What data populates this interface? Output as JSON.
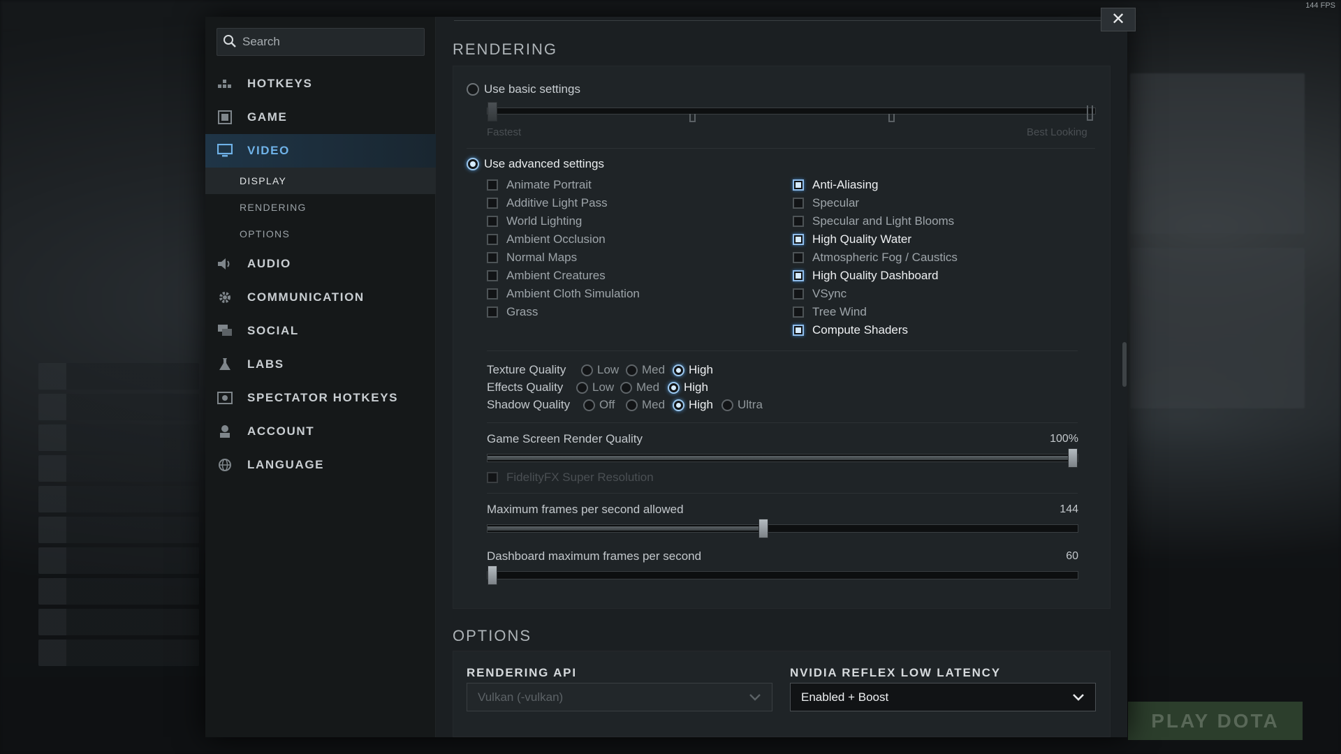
{
  "fps_counter": "144 FPS",
  "background": {
    "play_button": "PLAY DOTA"
  },
  "search": {
    "placeholder": "Search",
    "icon": "search-icon"
  },
  "nav": {
    "items": [
      {
        "label": "HOTKEYS",
        "icon": "hotkeys-icon",
        "active": false
      },
      {
        "label": "GAME",
        "icon": "game-icon",
        "active": false
      },
      {
        "label": "VIDEO",
        "icon": "monitor-icon",
        "active": true
      },
      {
        "label": "AUDIO",
        "icon": "speaker-icon",
        "active": false
      },
      {
        "label": "COMMUNICATION",
        "icon": "gear-icon",
        "active": false
      },
      {
        "label": "SOCIAL",
        "icon": "chat-icon",
        "active": false
      },
      {
        "label": "LABS",
        "icon": "flask-icon",
        "active": false
      },
      {
        "label": "SPECTATOR HOTKEYS",
        "icon": "eye-icon",
        "active": false
      },
      {
        "label": "ACCOUNT",
        "icon": "user-icon",
        "active": false
      },
      {
        "label": "LANGUAGE",
        "icon": "globe-icon",
        "active": false
      }
    ],
    "video_subitems": [
      {
        "label": "DISPLAY",
        "active": true
      },
      {
        "label": "RENDERING",
        "active": false
      },
      {
        "label": "OPTIONS",
        "active": false
      }
    ]
  },
  "rendering": {
    "title": "RENDERING",
    "basic": {
      "label": "Use basic settings",
      "selected": false,
      "min_label": "Fastest",
      "max_label": "Best Looking"
    },
    "advanced": {
      "label": "Use advanced settings",
      "selected": true
    },
    "checkboxes_left": [
      {
        "label": "Animate Portrait",
        "checked": false
      },
      {
        "label": "Additive Light Pass",
        "checked": false
      },
      {
        "label": "World Lighting",
        "checked": false
      },
      {
        "label": "Ambient Occlusion",
        "checked": false
      },
      {
        "label": "Normal Maps",
        "checked": false
      },
      {
        "label": "Ambient Creatures",
        "checked": false
      },
      {
        "label": "Ambient Cloth Simulation",
        "checked": false
      },
      {
        "label": "Grass",
        "checked": false
      }
    ],
    "checkboxes_right": [
      {
        "label": "Anti-Aliasing",
        "checked": true
      },
      {
        "label": "Specular",
        "checked": false
      },
      {
        "label": "Specular and Light Blooms",
        "checked": false
      },
      {
        "label": "High Quality Water",
        "checked": true
      },
      {
        "label": "Atmospheric Fog / Caustics",
        "checked": false
      },
      {
        "label": "High Quality Dashboard",
        "checked": true
      },
      {
        "label": "VSync",
        "checked": false
      },
      {
        "label": "Tree Wind",
        "checked": false
      },
      {
        "label": "Compute Shaders",
        "checked": true
      }
    ],
    "texture_quality": {
      "label": "Texture Quality",
      "options": [
        "Low",
        "Med",
        "High"
      ],
      "selected": "High"
    },
    "effects_quality": {
      "label": "Effects Quality",
      "options": [
        "Low",
        "Med",
        "High"
      ],
      "selected": "High"
    },
    "shadow_quality": {
      "label": "Shadow Quality",
      "options": [
        "Off",
        "Med",
        "High",
        "Ultra"
      ],
      "selected": "High"
    },
    "render_quality": {
      "label": "Game Screen Render Quality",
      "value_text": "100%",
      "value": 100,
      "min": 0,
      "max": 100
    },
    "fidelityfx": {
      "label": "FidelityFX Super Resolution",
      "checked": false,
      "disabled": true
    },
    "max_fps": {
      "label": "Maximum frames per second allowed",
      "value_text": "144",
      "value": 144,
      "min": 60,
      "max": 240
    },
    "dashboard_fps": {
      "label": "Dashboard maximum frames per second",
      "value_text": "60",
      "value": 60,
      "min": 60,
      "max": 240
    }
  },
  "options": {
    "title": "OPTIONS",
    "rendering_api": {
      "heading": "RENDERING API",
      "value": "Vulkan (-vulkan)",
      "disabled": true
    },
    "nvidia_reflex": {
      "heading": "NVIDIA REFLEX LOW LATENCY",
      "value": "Enabled + Boost",
      "disabled": false
    }
  },
  "close_button": {
    "label": "✕"
  }
}
